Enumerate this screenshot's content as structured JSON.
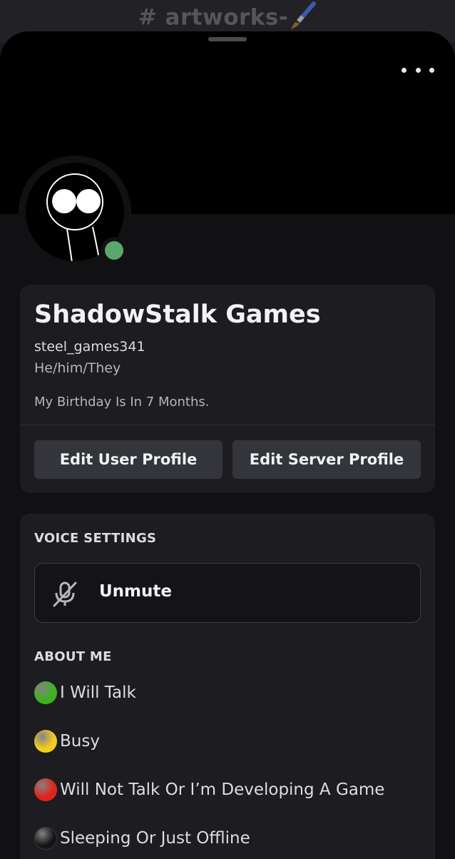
{
  "channel": {
    "title": "# artworks-"
  },
  "profile": {
    "display_name": "ShadowStalk Games",
    "username": "steel_games341",
    "pronouns": "He/him/They",
    "bio": "My Birthday Is In 7 Months.",
    "status_color": "#5aa76b",
    "edit_user_label": "Edit User Profile",
    "edit_server_label": "Edit Server Profile"
  },
  "voice": {
    "section_label": "VOICE SETTINGS",
    "unmute_label": "Unmute",
    "icon": "mic-muted-icon"
  },
  "about": {
    "section_label": "ABOUT ME",
    "lines": [
      {
        "color": "#3fb21f",
        "text": "I Will Talk"
      },
      {
        "color": "#f2cc20",
        "text": "Busy"
      },
      {
        "color": "#e0231b",
        "text": "Will Not Talk Or I’m Developing A Game"
      },
      {
        "color": "#141414",
        "text": "Sleeping  Or Just Offline"
      }
    ]
  },
  "colors": {
    "sheet_bg": "#111114",
    "card_bg": "#1c1c21",
    "button_bg": "#34353b"
  }
}
